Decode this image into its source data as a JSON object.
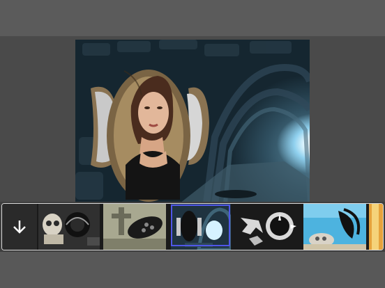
{
  "app": {
    "accent_color": "#4f57e8",
    "background_color": "#444444"
  },
  "editor": {
    "photo_subject": "tunnel-with-portrait-frame"
  },
  "frames_strip": {
    "download_icon": "arrow-down-icon",
    "selected_index": 2,
    "frames": [
      {
        "name": "skull-frame"
      },
      {
        "name": "cross-frame"
      },
      {
        "name": "tunnel-frame"
      },
      {
        "name": "hands-frame"
      },
      {
        "name": "underwater-skull-frame"
      },
      {
        "name": "sunset-frame"
      }
    ]
  }
}
